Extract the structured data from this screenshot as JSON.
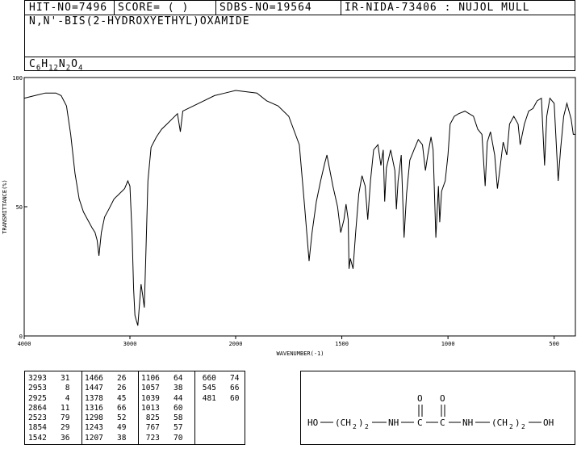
{
  "header": {
    "hit_no": "HIT-NO=7496",
    "score": "SCORE=  (   )",
    "sdbs_no": "SDBS-NO=19564",
    "ir_code": "IR-NIDA-73406 : NUJOL MULL",
    "compound_name": "N,N'-BIS(2-HYDROXYETHYL)OXAMIDE",
    "formula": {
      "c": "C",
      "c_n": "6",
      "h": "H",
      "h_n": "12",
      "n": "N",
      "n_n": "2",
      "o": "O",
      "o_n": "4"
    }
  },
  "chart_data": {
    "type": "line",
    "title": "",
    "xlabel": "WAVENUMBER(-1)",
    "ylabel": "TRANSMITTANCE(%)",
    "xlim": [
      4000,
      400
    ],
    "ylim": [
      0,
      100
    ],
    "x_ticks": [
      4000,
      3000,
      2000,
      1500,
      1000,
      500
    ],
    "y_ticks": [
      0,
      50,
      100
    ],
    "series": [
      {
        "points": [
          [
            4000,
            92
          ],
          [
            3900,
            93
          ],
          [
            3800,
            94
          ],
          [
            3700,
            94
          ],
          [
            3650,
            93
          ],
          [
            3600,
            89
          ],
          [
            3560,
            78
          ],
          [
            3520,
            63
          ],
          [
            3480,
            53
          ],
          [
            3440,
            48
          ],
          [
            3400,
            45
          ],
          [
            3360,
            42
          ],
          [
            3330,
            40
          ],
          [
            3310,
            37
          ],
          [
            3293,
            31
          ],
          [
            3270,
            40
          ],
          [
            3240,
            46
          ],
          [
            3200,
            49
          ],
          [
            3150,
            53
          ],
          [
            3100,
            55
          ],
          [
            3050,
            57
          ],
          [
            3020,
            60
          ],
          [
            3000,
            58
          ],
          [
            2980,
            40
          ],
          [
            2965,
            18
          ],
          [
            2953,
            8
          ],
          [
            2940,
            6
          ],
          [
            2925,
            4
          ],
          [
            2910,
            12
          ],
          [
            2895,
            20
          ],
          [
            2880,
            16
          ],
          [
            2864,
            11
          ],
          [
            2850,
            30
          ],
          [
            2830,
            60
          ],
          [
            2800,
            73
          ],
          [
            2750,
            77
          ],
          [
            2700,
            80
          ],
          [
            2650,
            82
          ],
          [
            2600,
            84
          ],
          [
            2550,
            86
          ],
          [
            2523,
            79
          ],
          [
            2500,
            87
          ],
          [
            2400,
            89
          ],
          [
            2300,
            91
          ],
          [
            2200,
            93
          ],
          [
            2100,
            94
          ],
          [
            2000,
            95
          ],
          [
            1900,
            94
          ],
          [
            1854,
            91
          ],
          [
            1800,
            89
          ],
          [
            1750,
            85
          ],
          [
            1700,
            74
          ],
          [
            1675,
            50
          ],
          [
            1654,
            29
          ],
          [
            1640,
            40
          ],
          [
            1620,
            52
          ],
          [
            1600,
            60
          ],
          [
            1580,
            67
          ],
          [
            1570,
            70
          ],
          [
            1542,
            58
          ],
          [
            1520,
            50
          ],
          [
            1505,
            40
          ],
          [
            1490,
            45
          ],
          [
            1480,
            51
          ],
          [
            1470,
            45
          ],
          [
            1466,
            26
          ],
          [
            1460,
            30
          ],
          [
            1447,
            26
          ],
          [
            1435,
            40
          ],
          [
            1420,
            55
          ],
          [
            1405,
            62
          ],
          [
            1390,
            58
          ],
          [
            1378,
            45
          ],
          [
            1365,
            60
          ],
          [
            1350,
            72
          ],
          [
            1330,
            74
          ],
          [
            1316,
            66
          ],
          [
            1305,
            72
          ],
          [
            1298,
            52
          ],
          [
            1290,
            65
          ],
          [
            1270,
            72
          ],
          [
            1250,
            64
          ],
          [
            1243,
            49
          ],
          [
            1235,
            60
          ],
          [
            1220,
            70
          ],
          [
            1207,
            38
          ],
          [
            1195,
            55
          ],
          [
            1180,
            68
          ],
          [
            1160,
            72
          ],
          [
            1140,
            76
          ],
          [
            1120,
            74
          ],
          [
            1106,
            64
          ],
          [
            1095,
            70
          ],
          [
            1080,
            77
          ],
          [
            1070,
            72
          ],
          [
            1057,
            38
          ],
          [
            1050,
            50
          ],
          [
            1045,
            58
          ],
          [
            1039,
            44
          ],
          [
            1030,
            56
          ],
          [
            1013,
            60
          ],
          [
            1000,
            70
          ],
          [
            990,
            82
          ],
          [
            970,
            85
          ],
          [
            950,
            86
          ],
          [
            920,
            87
          ],
          [
            900,
            86
          ],
          [
            880,
            85
          ],
          [
            860,
            80
          ],
          [
            840,
            78
          ],
          [
            825,
            58
          ],
          [
            815,
            75
          ],
          [
            800,
            79
          ],
          [
            780,
            70
          ],
          [
            767,
            57
          ],
          [
            755,
            65
          ],
          [
            740,
            75
          ],
          [
            723,
            70
          ],
          [
            710,
            82
          ],
          [
            690,
            85
          ],
          [
            670,
            82
          ],
          [
            660,
            74
          ],
          [
            640,
            82
          ],
          [
            620,
            87
          ],
          [
            600,
            88
          ],
          [
            580,
            91
          ],
          [
            560,
            92
          ],
          [
            545,
            66
          ],
          [
            535,
            85
          ],
          [
            520,
            92
          ],
          [
            500,
            90
          ],
          [
            481,
            60
          ],
          [
            470,
            72
          ],
          [
            455,
            85
          ],
          [
            440,
            90
          ],
          [
            420,
            84
          ],
          [
            410,
            78
          ],
          [
            400,
            78
          ]
        ]
      }
    ]
  },
  "peak_table": [
    [
      "3293",
      "31"
    ],
    [
      "2953",
      "8"
    ],
    [
      "2925",
      "4"
    ],
    [
      "2864",
      "11"
    ],
    [
      "2523",
      "79"
    ],
    [
      "1854",
      "29"
    ],
    [
      "1542",
      "36"
    ],
    [
      "1466",
      "26"
    ],
    [
      "1447",
      "26"
    ],
    [
      "1378",
      "45"
    ],
    [
      "1316",
      "66"
    ],
    [
      "1298",
      "52"
    ],
    [
      "1243",
      "49"
    ],
    [
      "1207",
      "38"
    ],
    [
      "1106",
      "64"
    ],
    [
      "1057",
      "38"
    ],
    [
      "1039",
      "44"
    ],
    [
      "1013",
      "60"
    ],
    [
      "825",
      "58"
    ],
    [
      "767",
      "57"
    ],
    [
      "723",
      "70"
    ],
    [
      "660",
      "74"
    ],
    [
      "545",
      "66"
    ],
    [
      "481",
      "60"
    ]
  ],
  "structure": {
    "ho_left": "HO",
    "ch2_left": "(CH",
    "ch2_left_sub": "2",
    "ch2_left_close": ")",
    "ch2_left_n": "2",
    "nh_left": "NH",
    "o_left": "O",
    "c_left": "C",
    "o_right": "O",
    "c_right": "C",
    "nh_right": "NH",
    "ch2_right": "(CH",
    "ch2_right_sub": "2",
    "ch2_right_close": ")",
    "ch2_right_n": "2",
    "oh_right": "OH"
  }
}
